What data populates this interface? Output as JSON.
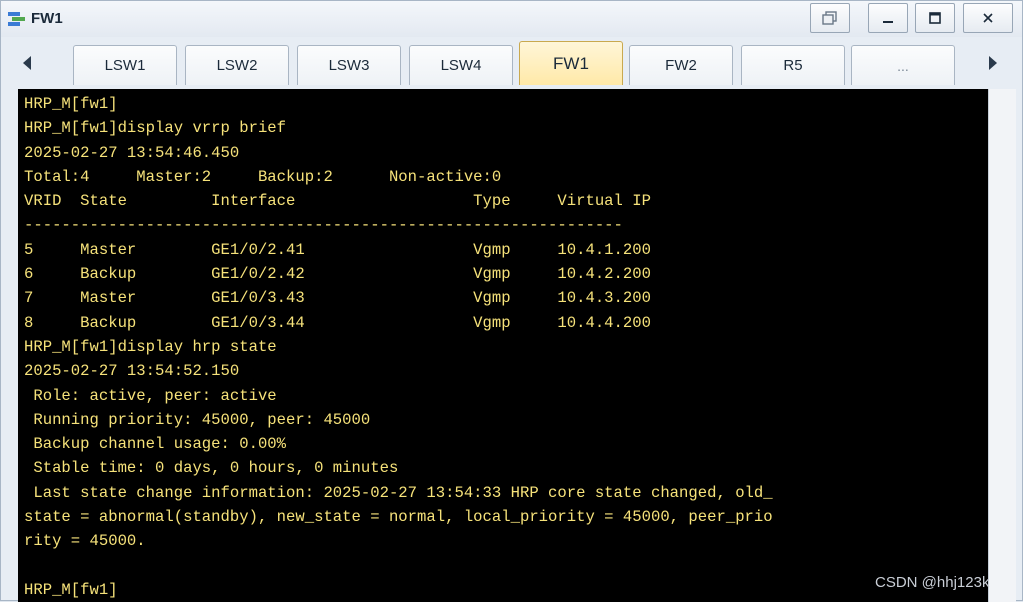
{
  "window": {
    "title": "FW1"
  },
  "tabs": [
    {
      "label": "LSW1",
      "active": false
    },
    {
      "label": "LSW2",
      "active": false
    },
    {
      "label": "LSW3",
      "active": false
    },
    {
      "label": "LSW4",
      "active": false
    },
    {
      "label": "FW1",
      "active": true
    },
    {
      "label": "FW2",
      "active": false
    },
    {
      "label": "R5",
      "active": false
    },
    {
      "label": "...",
      "active": false
    }
  ],
  "terminal": {
    "lines": [
      "HRP_M[fw1]",
      "HRP_M[fw1]display vrrp brief",
      "2025-02-27 13:54:46.450",
      "Total:4     Master:2     Backup:2      Non-active:0",
      "VRID  State         Interface                   Type     Virtual IP",
      "----------------------------------------------------------------",
      "5     Master        GE1/0/2.41                  Vgmp     10.4.1.200",
      "6     Backup        GE1/0/2.42                  Vgmp     10.4.2.200",
      "7     Master        GE1/0/3.43                  Vgmp     10.4.3.200",
      "8     Backup        GE1/0/3.44                  Vgmp     10.4.4.200",
      "HRP_M[fw1]display hrp state",
      "2025-02-27 13:54:52.150",
      " Role: active, peer: active",
      " Running priority: 45000, peer: 45000",
      " Backup channel usage: 0.00%",
      " Stable time: 0 days, 0 hours, 0 minutes",
      " Last state change information: 2025-02-27 13:54:33 HRP core state changed, old_",
      "state = abnormal(standby), new_state = normal, local_priority = 45000, peer_prio",
      "rity = 45000.",
      "",
      "HRP_M[fw1]",
      "HRP_M[fw1]"
    ]
  },
  "watermark": "CSDN @hhj123k"
}
